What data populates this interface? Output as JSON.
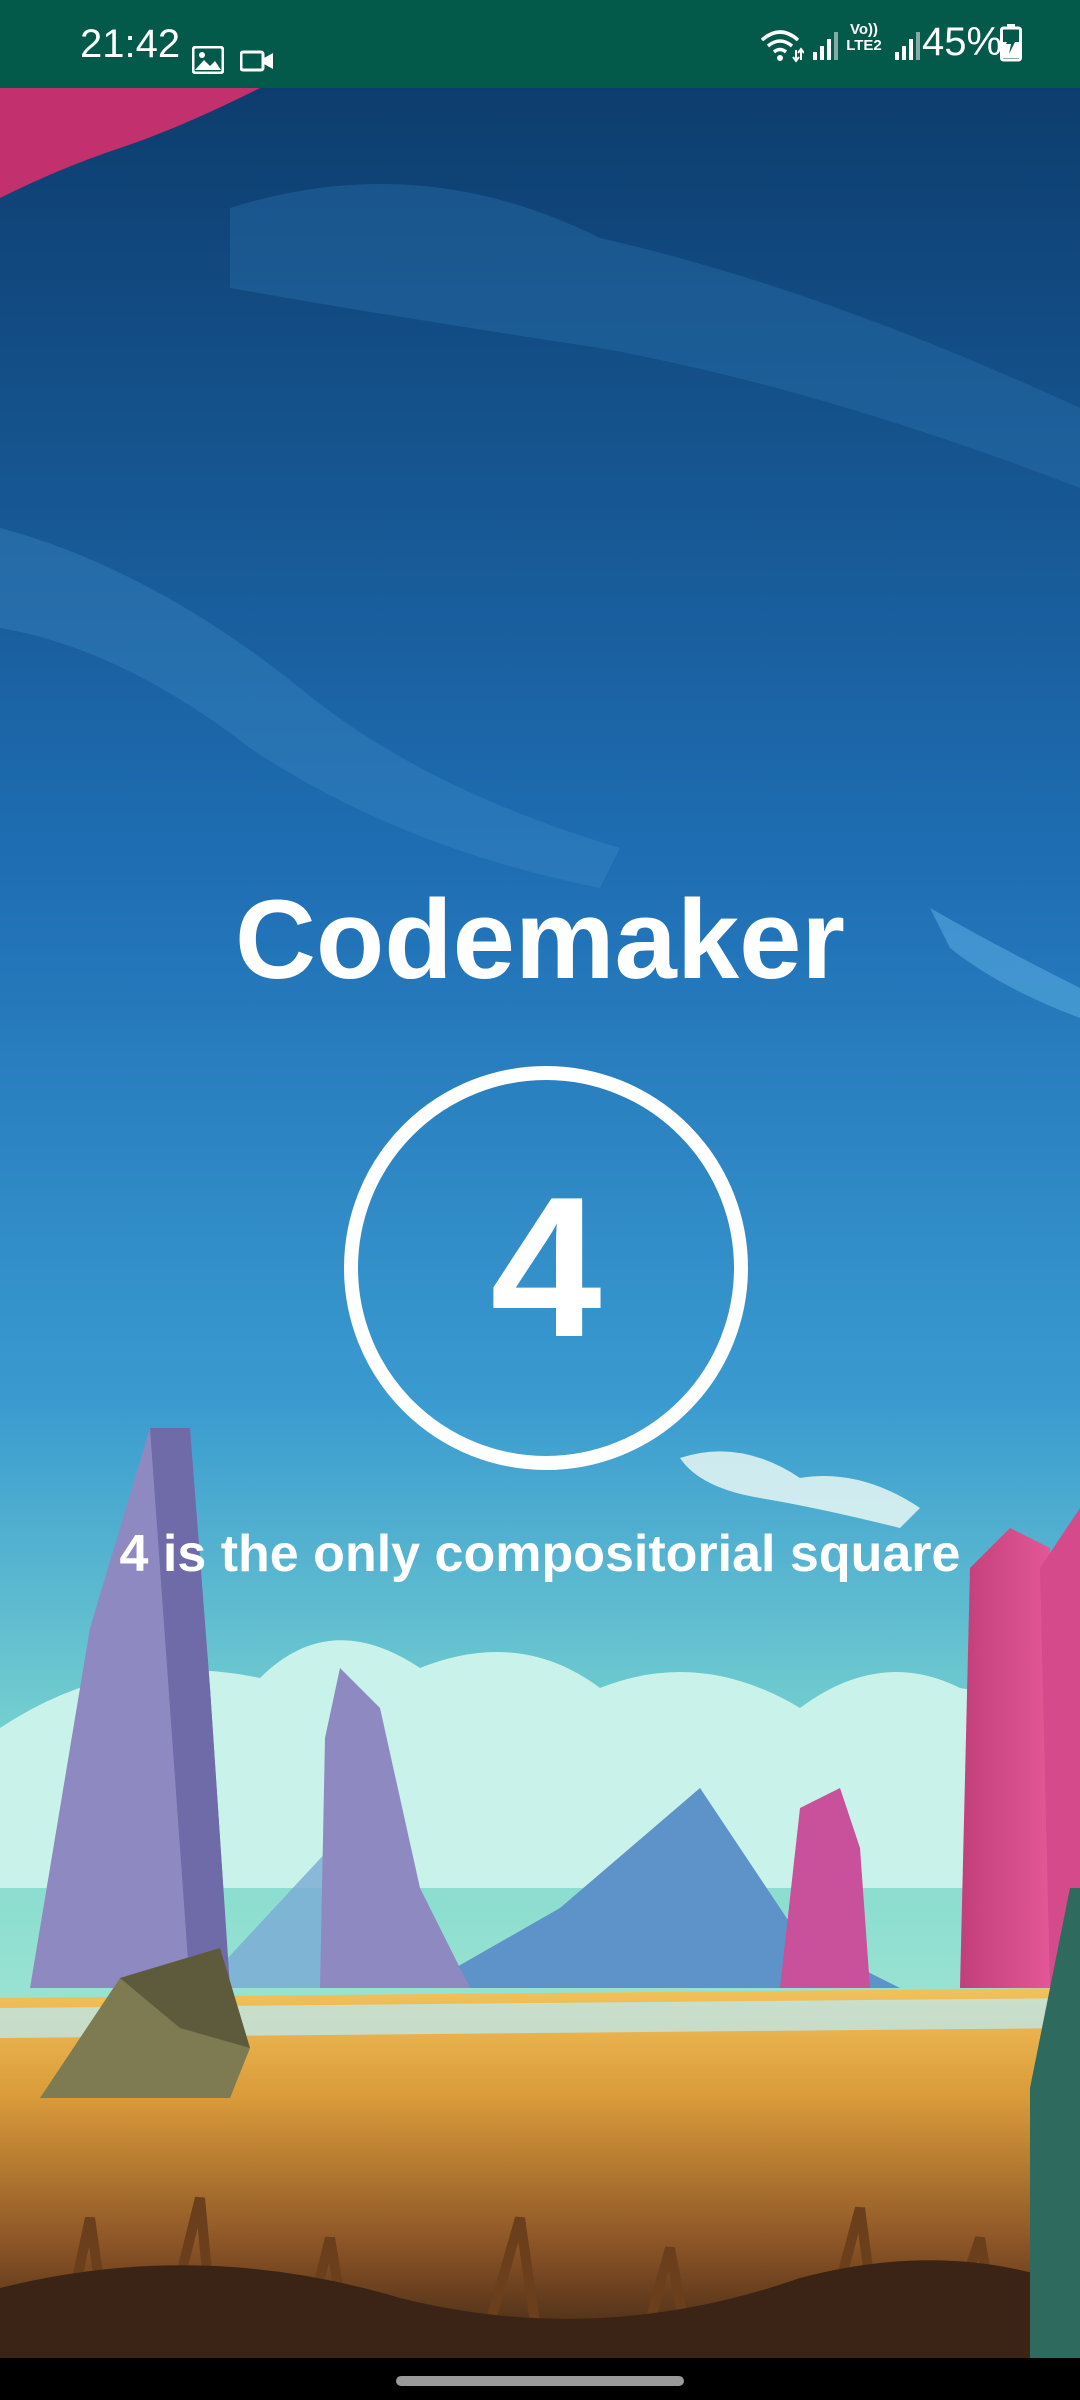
{
  "status_bar": {
    "time": "21:42",
    "network_label_top": "Vo))",
    "network_label_bottom": "LTE2",
    "battery": "45%",
    "icons": [
      "gallery-icon",
      "video-icon",
      "wifi-icon",
      "signal-icon",
      "signal-icon",
      "battery-charging-icon"
    ],
    "background_color": "#03594a"
  },
  "main": {
    "title": "Codemaker",
    "number": "4",
    "fact": "4 is the only compositorial square"
  },
  "colors": {
    "text": "#ffffff",
    "sky_top": "#0d3d6e",
    "sky_bottom": "#7fd9cf"
  }
}
